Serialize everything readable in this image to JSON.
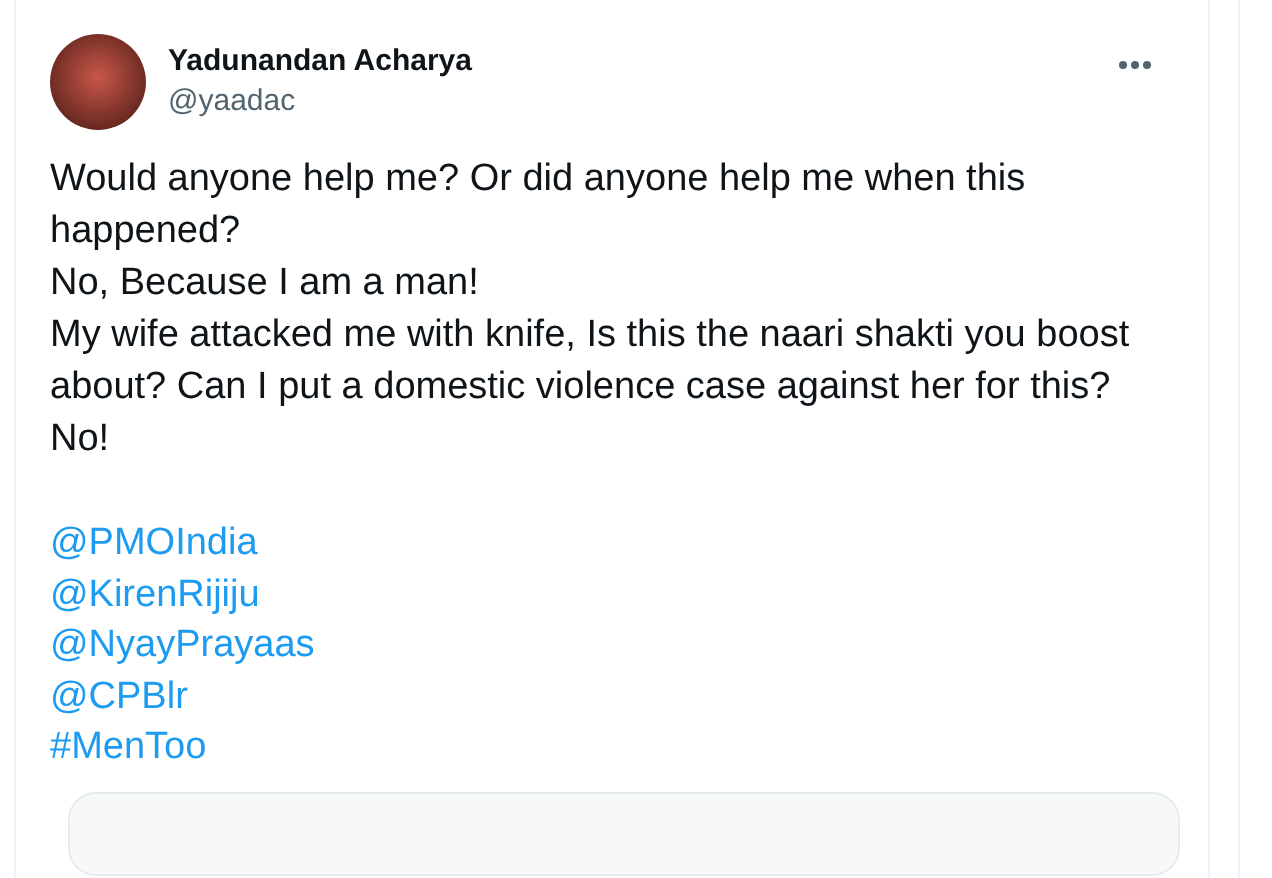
{
  "author": {
    "name": "Yadunandan Acharya",
    "handle": "@yaadac"
  },
  "body": [
    "Would anyone help me? Or did anyone help me when this happened?",
    "No, Because I am a man!",
    "My wife attacked me with knife, Is this the naari shakti you boost about? Can I put a domestic violence case against her for this? No!"
  ],
  "links": [
    "@PMOIndia",
    "@KirenRijiju",
    "@NyayPrayaas",
    "@CPBlr",
    "#MenToo"
  ]
}
